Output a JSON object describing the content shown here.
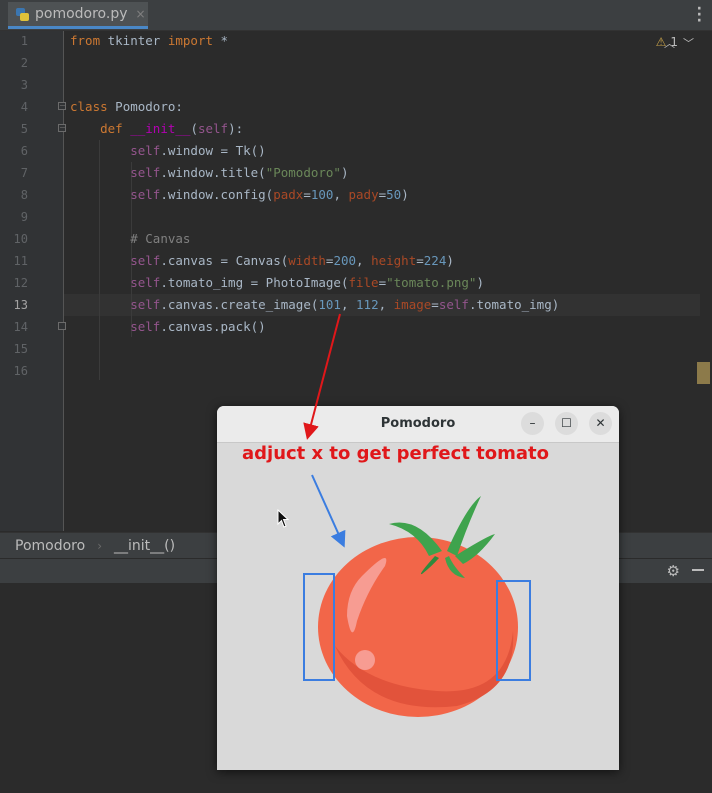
{
  "editor_tab": {
    "filename": "pomodoro.py",
    "close_glyph": "×"
  },
  "inspections": {
    "warning_count": "1"
  },
  "line_numbers": [
    "1",
    "2",
    "3",
    "4",
    "5",
    "6",
    "7",
    "8",
    "9",
    "10",
    "11",
    "12",
    "13",
    "14",
    "15",
    "16"
  ],
  "current_line": "13",
  "breadcrumb": {
    "items": [
      "Pomodoro",
      "__init__()"
    ]
  },
  "tk_window": {
    "title": "Pomodoro"
  },
  "annotation": {
    "text": "adjuct x to get perfect tomato"
  },
  "colors": {
    "annotation_red": "#e0171a",
    "guide_blue": "#3b7de0",
    "tomato": "#f26649",
    "leaf": "#3fa34d"
  },
  "icons": [
    "python-file-icon",
    "close-icon",
    "more-icon",
    "warning-icon",
    "chevron-up-icon",
    "chevron-down-icon",
    "fold-icon",
    "gear-icon",
    "minimize-icon",
    "maximize-icon",
    "mouse-cursor-icon",
    "tomato-image"
  ]
}
